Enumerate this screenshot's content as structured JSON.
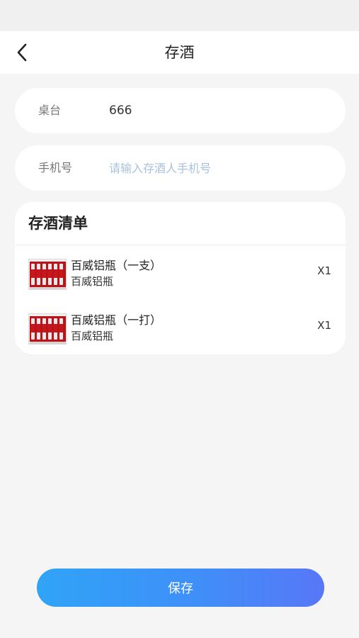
{
  "header": {
    "title": "存酒",
    "back_icon": "chevron-left-icon"
  },
  "form": {
    "table": {
      "label": "桌台",
      "value": "666"
    },
    "phone": {
      "label": "手机号",
      "placeholder": "请输入存酒人手机号",
      "value": ""
    }
  },
  "list": {
    "title": "存酒清单",
    "items": [
      {
        "name": "百威铝瓶（一支）",
        "sub": "百威铝瓶",
        "qty": "X1",
        "thumb_icon": "beer-cans-image"
      },
      {
        "name": "百威铝瓶（一打）",
        "sub": "百威铝瓶",
        "qty": "X1",
        "thumb_icon": "beer-cans-image"
      }
    ]
  },
  "footer": {
    "save_label": "保存"
  },
  "colors": {
    "accent_start": "#2fa4f7",
    "accent_end": "#5877f8",
    "placeholder": "#a9c2dc",
    "background": "#f5f5f5"
  }
}
